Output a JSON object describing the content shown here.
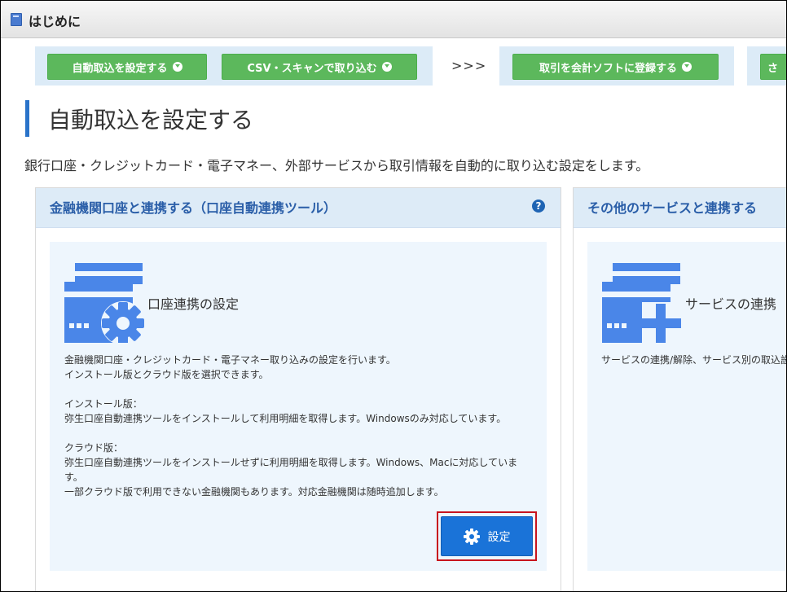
{
  "window": {
    "title": "はじめに"
  },
  "steps": {
    "btn1": "自動取込を設定する",
    "btn2": "CSV・スキャンで取り込む",
    "separator": ">>>",
    "btn3": "取引を会計ソフトに登録する",
    "btn4": "さ"
  },
  "section": {
    "title": "自動取込を設定する",
    "description": "銀行口座・クレジットカード・電子マネー、外部サービスから取引情報を自動的に取り込む設定をします。"
  },
  "panel_bank": {
    "header": "金融機関口座と連携する（口座自動連携ツール）",
    "help_icon": "?",
    "card_title": "口座連携の設定",
    "text1": "金融機関口座・クレジットカード・電子マネー取り込みの設定を行います。\nインストール版とクラウド版を選択できます。",
    "text2": "インストール版：\n弥生口座自動連携ツールをインストールして利用明細を取得します。Windowsのみ対応しています。",
    "text3": "クラウド版：\n弥生口座自動連携ツールをインストールせずに利用明細を取得します。Windows、Macに対応していま\nす。\n一部クラウド版で利用できない金融機関もあります。対応金融機関は随時追加します。",
    "button": "設定"
  },
  "panel_other": {
    "header": "その他のサービスと連携する",
    "card_title": "サービスの連携",
    "text1": "サービスの連携/解除、サービス別の取込設"
  },
  "colors": {
    "accent_green": "#5cb85c",
    "accent_blue": "#1a73d8",
    "heading_blue": "#2a5ea8",
    "highlight_red": "#c8141e"
  }
}
